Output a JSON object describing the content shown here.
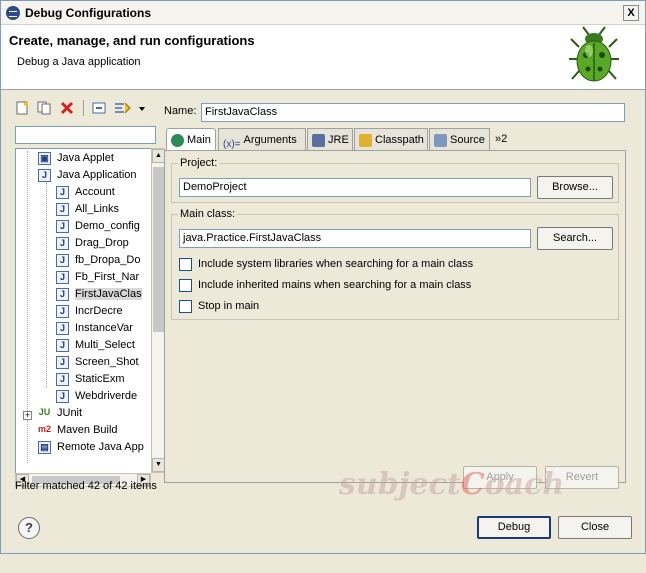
{
  "window": {
    "title": "Debug Configurations",
    "close_symbol": "X"
  },
  "header": {
    "title": "Create, manage, and run configurations",
    "subtitle": "Debug a Java application",
    "logo": "bug-logo"
  },
  "left_toolbar": {
    "icons": [
      "new-launch-config-icon",
      "duplicate-icon",
      "delete-icon",
      "collapse-all-icon",
      "filter-icon",
      "view-menu-icon"
    ],
    "delete_color": "#d42020"
  },
  "filter": {
    "value": ""
  },
  "tree": {
    "items": [
      {
        "label": "Java Applet",
        "icon": "applet-icon",
        "level": 1
      },
      {
        "label": "Java Application",
        "icon": "java-app-icon",
        "level": 1,
        "expanded": true
      },
      {
        "label": "Account",
        "icon": "J",
        "level": 2
      },
      {
        "label": "All_Links",
        "icon": "J",
        "level": 2
      },
      {
        "label": "Demo_config",
        "icon": "J",
        "level": 2
      },
      {
        "label": "Drag_Drop",
        "icon": "J",
        "level": 2
      },
      {
        "label": "fb_Dropa_Do",
        "icon": "J",
        "level": 2
      },
      {
        "label": "Fb_First_Nar",
        "icon": "J",
        "level": 2
      },
      {
        "label": "FirstJavaClas",
        "icon": "J",
        "level": 2,
        "selected": true
      },
      {
        "label": "IncrDecre",
        "icon": "J",
        "level": 2
      },
      {
        "label": "InstanceVar",
        "icon": "J",
        "level": 2
      },
      {
        "label": "Multi_Select",
        "icon": "J",
        "level": 2
      },
      {
        "label": "Screen_Shot",
        "icon": "J",
        "level": 2
      },
      {
        "label": "StaticExm",
        "icon": "J",
        "level": 2
      },
      {
        "label": "Webdriverde",
        "icon": "J",
        "level": 2
      },
      {
        "label": "JUnit",
        "icon": "JU",
        "level": 1,
        "collapsed": true
      },
      {
        "label": "Maven Build",
        "icon": "m2",
        "level": 1
      },
      {
        "label": "Remote Java App",
        "icon": "remote-icon",
        "level": 1
      }
    ],
    "status": "Filter matched 42 of 42 items"
  },
  "config": {
    "name_label": "Name:",
    "name_value": "FirstJavaClass",
    "tabs": [
      {
        "label": "Main",
        "icon": "main-tab-icon",
        "active": true
      },
      {
        "label": "Arguments",
        "icon": "arguments-icon"
      },
      {
        "label": "JRE",
        "icon": "jre-icon"
      },
      {
        "label": "Classpath",
        "icon": "classpath-icon"
      },
      {
        "label": "Source",
        "icon": "source-icon"
      },
      {
        "label": "»2",
        "icon": "more-tabs-icon"
      }
    ],
    "project": {
      "label": "Project:",
      "value": "DemoProject",
      "browse": "Browse..."
    },
    "main_class": {
      "label": "Main class:",
      "value": "java.Practice.FirstJavaClass",
      "search": "Search...",
      "checks": [
        {
          "label": "Include system libraries when searching for a main class",
          "checked": false
        },
        {
          "label": "Include inherited mains when searching for a main class",
          "checked": false
        },
        {
          "label": "Stop in main",
          "checked": false
        }
      ]
    },
    "apply": "Apply",
    "revert": "Revert"
  },
  "footer": {
    "help": "?",
    "debug": "Debug",
    "close": "Close"
  },
  "watermark": {
    "text_a": "subject",
    "text_c": "C",
    "text_b": "oach"
  }
}
